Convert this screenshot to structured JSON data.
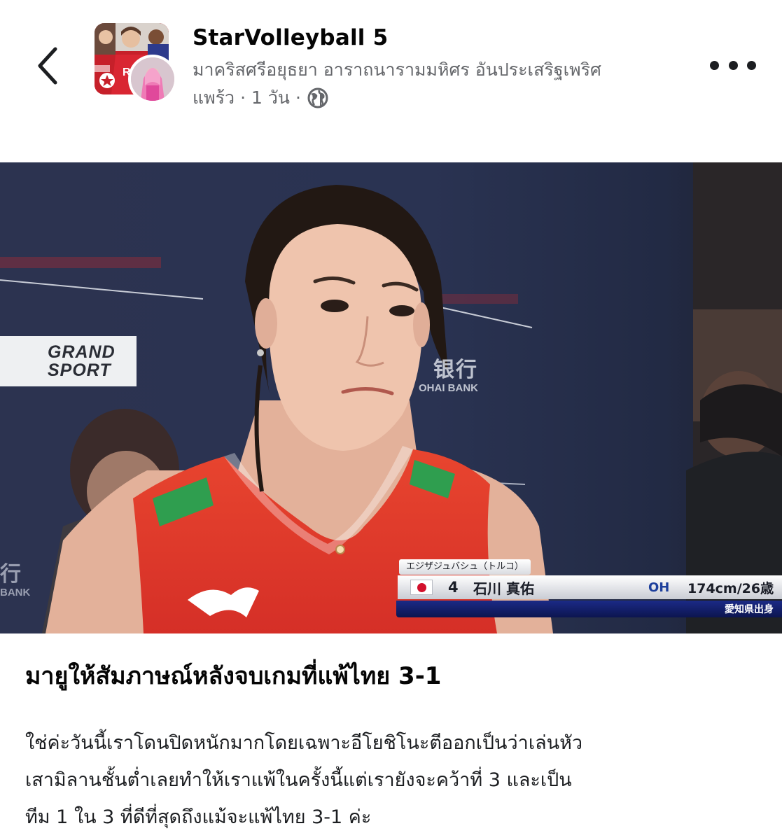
{
  "post": {
    "page_name": "StarVolleyball 5",
    "author": "มาคริสศรีอยุธยา อาราถนารามมหิศร อันประเสริฐเพริศ",
    "author_cont": "แพร้ว",
    "time": "1 วัน",
    "separator": "·",
    "privacy_icon": "globe-icon",
    "back_icon": "chevron-left-icon",
    "more_icon": "more-horizontal-icon"
  },
  "photo": {
    "sponsor": "GRAND\nSPORT",
    "bank_cn": "银行",
    "bank_en": "OHAI BANK",
    "bank2_cn": "行",
    "bank2_en": "BANK",
    "caption": {
      "team_line": "エジザジュバシュ（トルコ）",
      "number": "4",
      "name": "石川 真佑",
      "position": "OH",
      "height_age": "174cm/26歳",
      "hometown": "愛知県出身"
    }
  },
  "content": {
    "headline": "มายูให้สัมภาษณ์หลังจบเกมที่แพ้ไทย 3-1",
    "body_lines": [
      "ใช่ค่ะวันนี้เราโดนปิดหนักมากโดยเฉพาะอีโยชิโนะตีออกเป็นว่าเล่นหัว",
      "เสามิลานชั้นต่ำเลยทำให้เราแพ้ในครั้งนี้แต่เรายังจะคว้าที่ 3 และเป็น",
      "ทีม 1 ใน 3 ที่ดีที่สุดถึงแม้จะแพ้ไทย 3-1 ค่ะ"
    ]
  },
  "colors": {
    "text_primary": "#050505",
    "text_secondary": "#65676b",
    "jersey_red": "#e0362c",
    "caption_blue": "#1d3f9c"
  }
}
